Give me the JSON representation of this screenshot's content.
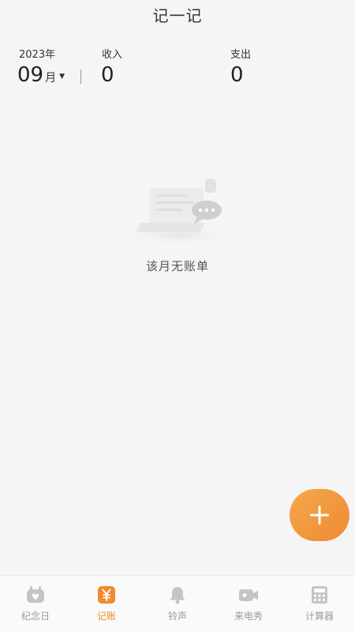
{
  "header": {
    "title": "记一记"
  },
  "summary": {
    "year_label": "2023年",
    "month_value": "09",
    "month_unit": "月",
    "income_label": "收入",
    "income_value": "0",
    "expense_label": "支出",
    "expense_value": "0"
  },
  "empty_state": {
    "message": "该月无账单"
  },
  "fab": {
    "icon": "plus-icon"
  },
  "tabbar": {
    "active_color": "#f08a2c",
    "inactive_color": "#9a9a9a",
    "items": [
      {
        "label": "纪念日",
        "icon": "anniversary-icon",
        "active": false
      },
      {
        "label": "记账",
        "icon": "yen-note-icon",
        "active": true
      },
      {
        "label": "铃声",
        "icon": "bell-icon",
        "active": false
      },
      {
        "label": "来电秀",
        "icon": "video-icon",
        "active": false
      },
      {
        "label": "计算器",
        "icon": "calculator-icon",
        "active": false
      }
    ]
  }
}
